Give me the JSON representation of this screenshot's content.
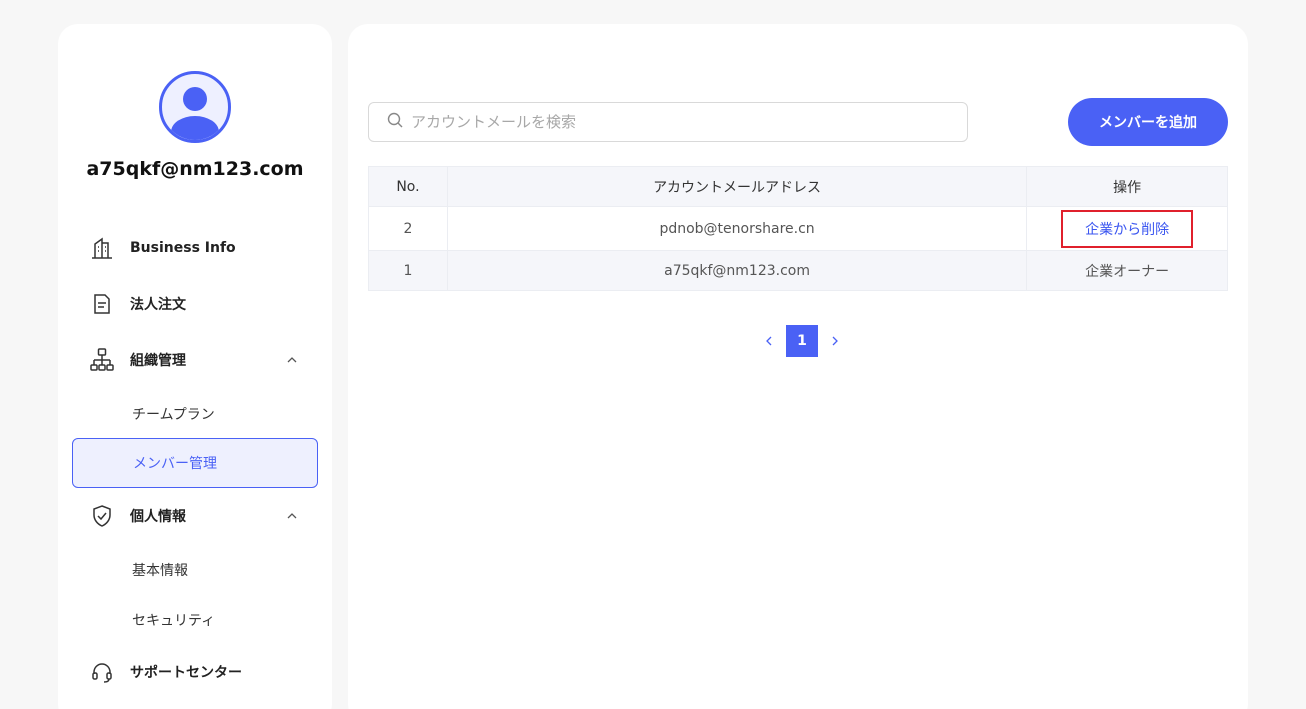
{
  "sidebar": {
    "user_email": "a75qkf@nm123.com",
    "nav": {
      "business_info": "Business Info",
      "corporate_orders": "法人注文",
      "org_management": "組織管理",
      "team_plan": "チームプラン",
      "member_management": "メンバー管理",
      "personal_info": "個人情報",
      "basic_info": "基本情報",
      "security": "セキュリティ",
      "support_center": "サポートセンター"
    }
  },
  "main": {
    "search_placeholder": "アカウントメールを検索",
    "add_member_label": "メンバーを追加",
    "table": {
      "headers": {
        "no": "No.",
        "email": "アカウントメールアドレス",
        "operation": "操作"
      },
      "rows": [
        {
          "no": "2",
          "email": "pdnob@tenorshare.cn",
          "action": "企業から削除"
        },
        {
          "no": "1",
          "email": "a75qkf@nm123.com",
          "role": "企業オーナー"
        }
      ]
    },
    "pagination": {
      "current_page": "1"
    }
  },
  "colors": {
    "accent": "#4a61f5",
    "highlight_border": "#e0202c"
  }
}
